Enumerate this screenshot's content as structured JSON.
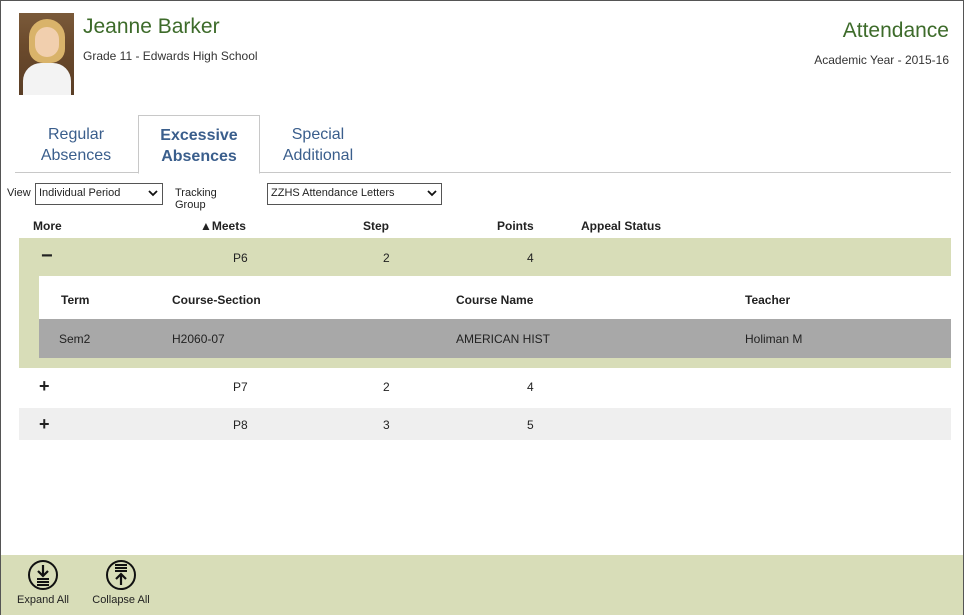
{
  "student": {
    "name": "Jeanne Barker",
    "grade_school": "Grade 11 - Edwards High School"
  },
  "app": {
    "title": "Attendance",
    "academic_year": "Academic Year - 2015-16"
  },
  "tabs": [
    {
      "line1": "Regular",
      "line2": "Absences",
      "active": false
    },
    {
      "line1": "Excessive",
      "line2": "Absences",
      "active": true
    },
    {
      "line1": "Special",
      "line2": "Additional",
      "active": false
    }
  ],
  "filters": {
    "view_label": "View",
    "view_value": "Individual Period",
    "tracking_label": "Tracking Group",
    "tracking_value": "ZZHS Attendance Letters"
  },
  "columns": {
    "more": "More",
    "meets": "▲Meets",
    "step": "Step",
    "points": "Points",
    "appeal_status": "Appeal Status"
  },
  "rows": [
    {
      "toggle": "−",
      "meets": "P6",
      "step": "2",
      "points": "4",
      "appeal_status": "",
      "expanded": true
    },
    {
      "toggle": "+",
      "meets": "P7",
      "step": "2",
      "points": "4",
      "appeal_status": "",
      "expanded": false
    },
    {
      "toggle": "+",
      "meets": "P8",
      "step": "3",
      "points": "5",
      "appeal_status": "",
      "expanded": false
    }
  ],
  "detail": {
    "headers": {
      "term": "Term",
      "course_section": "Course-Section",
      "course_name": "Course Name",
      "teacher": "Teacher"
    },
    "rows": [
      {
        "term": "Sem2",
        "course_section": "H2060-07",
        "course_name": "AMERICAN HIST",
        "teacher": "Holiman M"
      }
    ]
  },
  "footer": {
    "expand_all": "Expand All",
    "collapse_all": "Collapse All"
  },
  "colors": {
    "accent_green": "#3d6b2a",
    "tab_blue": "#3a5e8c",
    "band_green": "#d8ddb8",
    "detail_gray": "#a8a8a8"
  },
  "icons": {
    "expand_all": "expand-all-icon",
    "collapse_all": "collapse-all-icon",
    "dropdown": "chevron-down-icon"
  }
}
